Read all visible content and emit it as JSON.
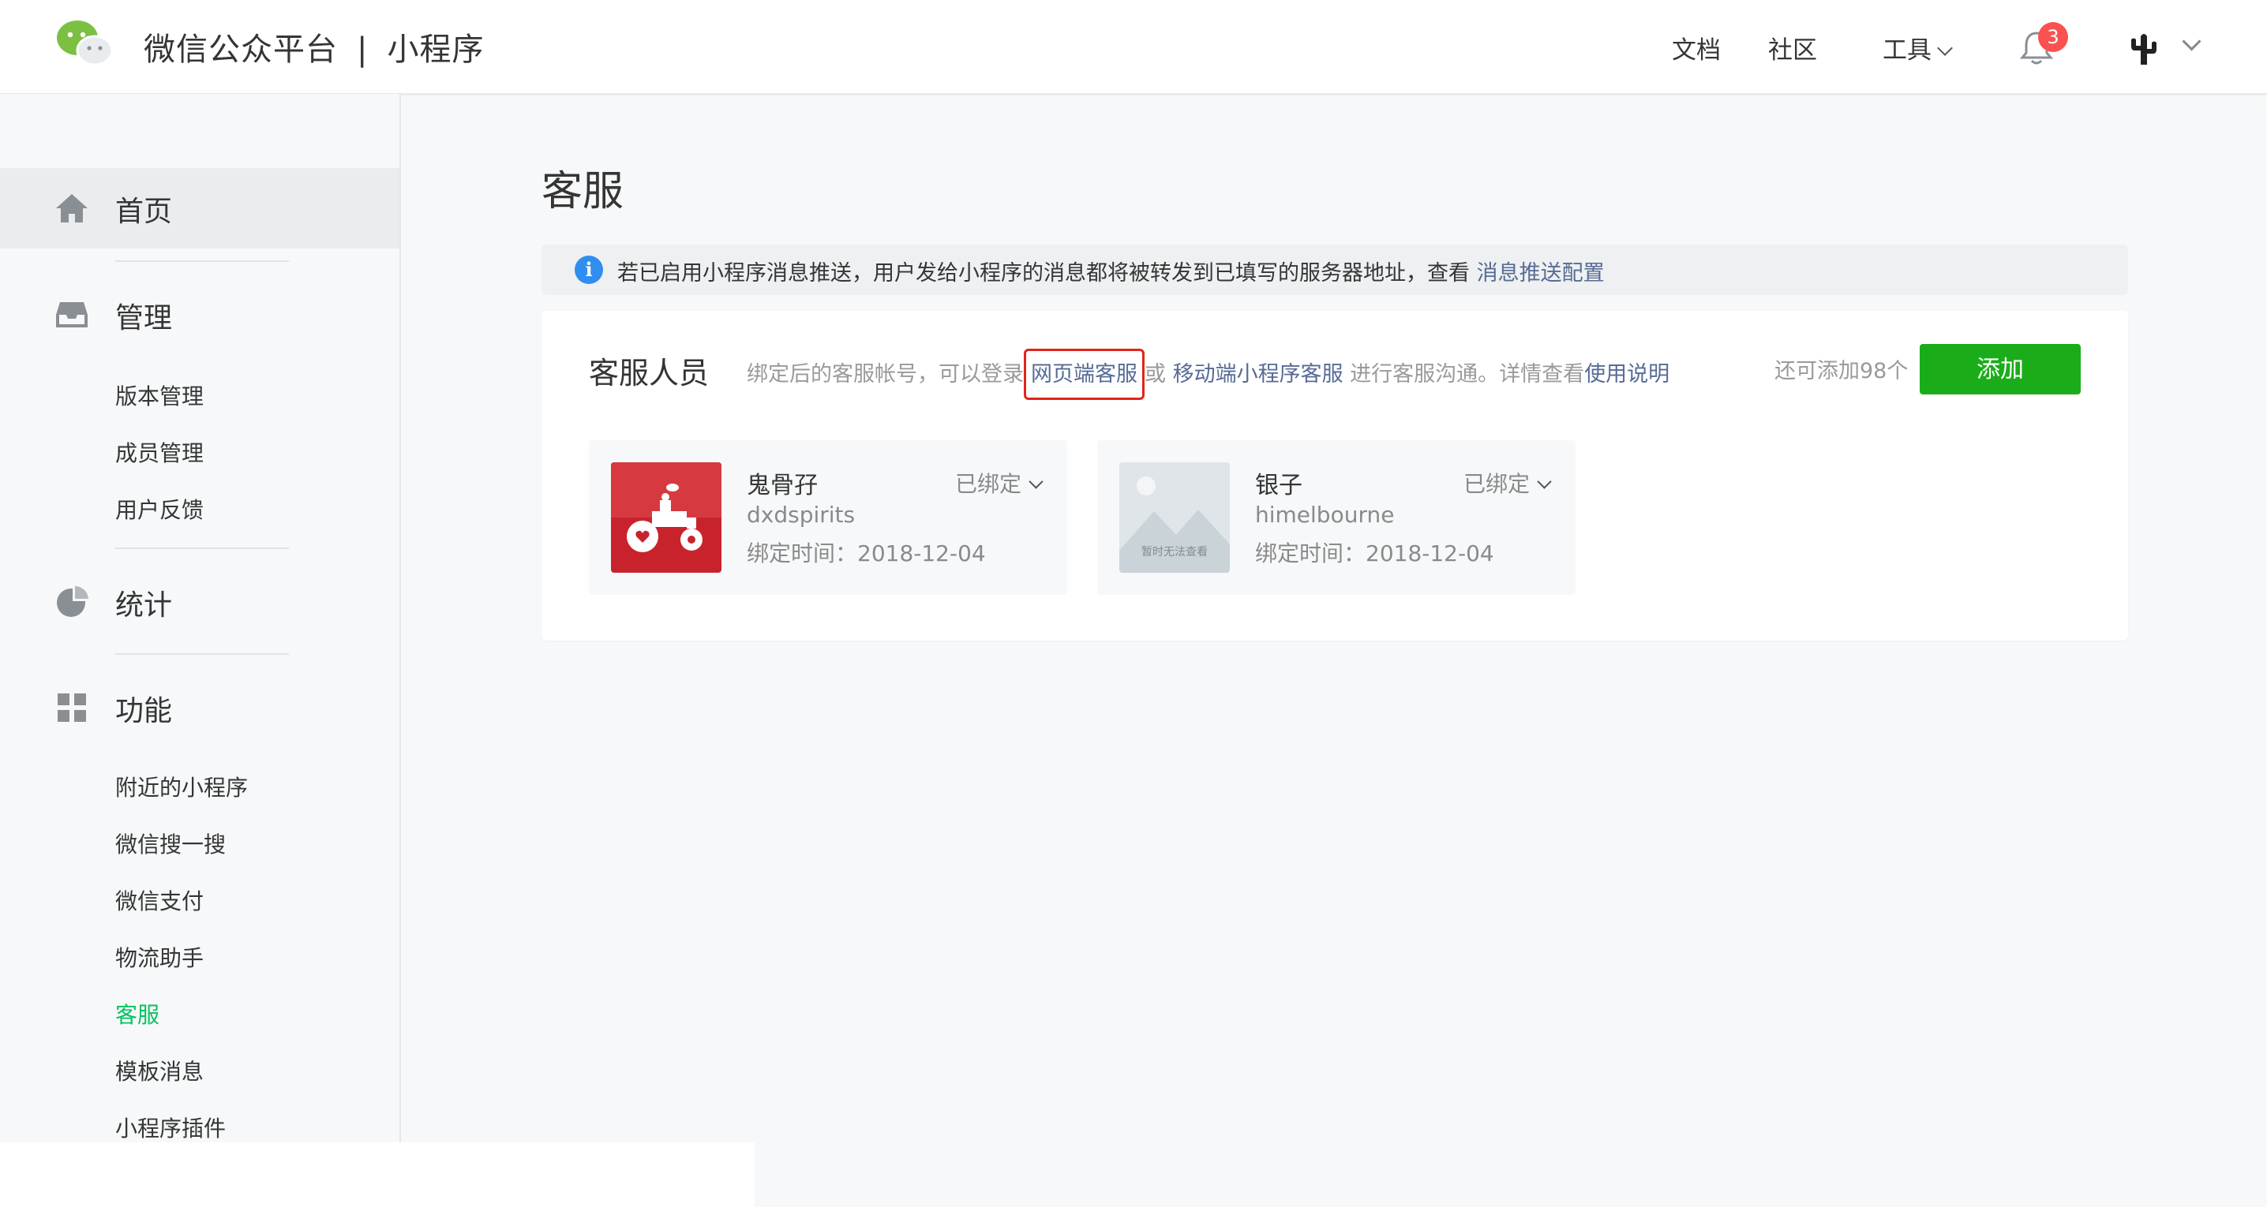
{
  "topbar": {
    "brand_name": "微信公众平台",
    "brand_sep": "|",
    "brand_product": "小程序",
    "nav": {
      "docs": "文档",
      "community": "社区",
      "tools": "工具"
    },
    "notification_count": "3",
    "icons": {
      "logo": "wechat-logo-icon",
      "bell": "bell-icon",
      "avatar": "cactus-avatar-icon",
      "user_menu": "chevron-down-icon"
    }
  },
  "sidebar": {
    "home": "首页",
    "manage": "管理",
    "manage_items": [
      "版本管理",
      "成员管理",
      "用户反馈"
    ],
    "stats": "统计",
    "features": "功能",
    "feature_items": [
      "附近的小程序",
      "微信搜一搜",
      "微信支付",
      "物流助手",
      "客服",
      "模板消息",
      "小程序插件"
    ],
    "active_item": "客服",
    "accent_color": "#07c160"
  },
  "main": {
    "page_title": "客服",
    "notice": {
      "text": "若已启用小程序消息推送，用户发给小程序的消息都将被转发到已填写的服务器地址，查看 ",
      "link": "消息推送配置"
    },
    "panel": {
      "title": "客服人员",
      "desc_before": "绑定后的客服帐号，可以登录",
      "link_web": "网页端客服",
      "desc_or": "或 ",
      "link_mobile": "移动端小程序客服",
      "desc_after": " 进行客服沟通。详情查看",
      "link_help": "使用说明",
      "quota": "还可添加98个",
      "add_label": "添加",
      "add_color": "#1aad19"
    },
    "agents": [
      {
        "name": "鬼骨孖",
        "id": "dxdspirits",
        "bind_time": "绑定时间：2018-12-04",
        "status": "已绑定"
      },
      {
        "name": "银子",
        "id": "himelbourne",
        "bind_time": "绑定时间：2018-12-04",
        "status": "已绑定",
        "placeholder_text": "暂时无法查看"
      }
    ]
  }
}
